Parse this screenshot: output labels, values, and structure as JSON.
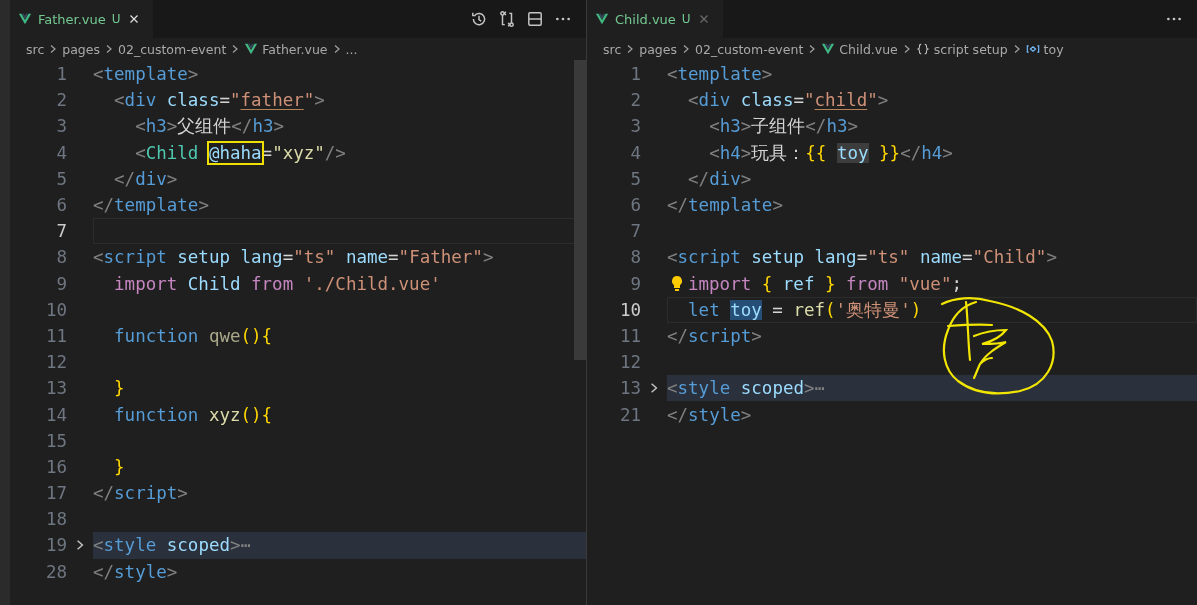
{
  "panes": [
    {
      "tab": {
        "label": "Father.vue",
        "status": "U",
        "focused": true
      },
      "actions": [
        {
          "kind": "history"
        },
        {
          "kind": "compare"
        },
        {
          "kind": "split"
        },
        {
          "kind": "more"
        }
      ],
      "breadcrumbs": [
        {
          "text": "src"
        },
        {
          "text": "pages"
        },
        {
          "text": "02_custom-event"
        },
        {
          "text": "Father.vue",
          "kind": "vue"
        },
        {
          "text": "..."
        }
      ],
      "scrollbar": true,
      "lines": [
        {
          "n": "1",
          "tokens": [
            {
              "text": "<",
              "kind": "p"
            },
            {
              "text": "template",
              "kind": "tag"
            },
            {
              "text": ">",
              "kind": "p"
            }
          ]
        },
        {
          "n": "2",
          "tokens": [
            {
              "text": "  <",
              "kind": "p"
            },
            {
              "text": "div",
              "kind": "tag"
            },
            {
              "text": " class",
              "kind": "attr"
            },
            {
              "text": "=",
              "kind": "plain"
            },
            {
              "text": "\"",
              "kind": "str"
            },
            {
              "text": "father",
              "kind": "str",
              "underlined": true
            },
            {
              "text": "\"",
              "kind": "str"
            },
            {
              "text": ">",
              "kind": "p"
            }
          ]
        },
        {
          "n": "3",
          "tokens": [
            {
              "text": "    <",
              "kind": "p"
            },
            {
              "text": "h3",
              "kind": "tag"
            },
            {
              "text": ">",
              "kind": "p"
            },
            {
              "text": "父组件",
              "kind": "plain"
            },
            {
              "text": "</",
              "kind": "p"
            },
            {
              "text": "h3",
              "kind": "tag"
            },
            {
              "text": ">",
              "kind": "p"
            }
          ]
        },
        {
          "n": "4",
          "tokens": [
            {
              "text": "    <",
              "kind": "p"
            },
            {
              "text": "Child ",
              "kind": "comp"
            },
            {
              "text": "@haha",
              "kind": "attr",
              "boxed": true
            },
            {
              "text": "=",
              "kind": "plain"
            },
            {
              "text": "\"xyz\"",
              "kind": "fn"
            },
            {
              "text": "/>",
              "kind": "p"
            }
          ]
        },
        {
          "n": "5",
          "tokens": [
            {
              "text": "  </",
              "kind": "p"
            },
            {
              "text": "div",
              "kind": "tag"
            },
            {
              "text": ">",
              "kind": "p"
            }
          ]
        },
        {
          "n": "6",
          "tokens": [
            {
              "text": "</",
              "kind": "p"
            },
            {
              "text": "template",
              "kind": "tag"
            },
            {
              "text": ">",
              "kind": "p"
            }
          ]
        },
        {
          "n": "7",
          "current": true
        },
        {
          "n": "8",
          "tokens": [
            {
              "text": "<",
              "kind": "p"
            },
            {
              "text": "script",
              "kind": "tag"
            },
            {
              "text": " setup lang",
              "kind": "attr"
            },
            {
              "text": "=",
              "kind": "plain"
            },
            {
              "text": "\"ts\"",
              "kind": "str"
            },
            {
              "text": " name",
              "kind": "attr"
            },
            {
              "text": "=",
              "kind": "plain"
            },
            {
              "text": "\"Father\"",
              "kind": "str"
            },
            {
              "text": ">",
              "kind": "p"
            }
          ]
        },
        {
          "n": "9",
          "tokens": [
            {
              "text": "  import",
              "kind": "kw"
            },
            {
              "text": " Child",
              "kind": "var"
            },
            {
              "text": " from",
              "kind": "kw"
            },
            {
              "text": " './Child.vue'",
              "kind": "str"
            }
          ]
        },
        {
          "n": "10"
        },
        {
          "n": "11",
          "tokens": [
            {
              "text": "  function",
              "kind": "store"
            },
            {
              "text": " qwe",
              "kind": "fndim"
            },
            {
              "text": "(){",
              "kind": "br"
            }
          ]
        },
        {
          "n": "12"
        },
        {
          "n": "13",
          "tokens": [
            {
              "text": "  }",
              "kind": "br"
            }
          ]
        },
        {
          "n": "14",
          "tokens": [
            {
              "text": "  function",
              "kind": "store"
            },
            {
              "text": " xyz",
              "kind": "fn"
            },
            {
              "text": "(){",
              "kind": "br"
            }
          ]
        },
        {
          "n": "15"
        },
        {
          "n": "16",
          "tokens": [
            {
              "text": "  }",
              "kind": "br"
            }
          ]
        },
        {
          "n": "17",
          "tokens": [
            {
              "text": "</",
              "kind": "p"
            },
            {
              "text": "script",
              "kind": "tag"
            },
            {
              "text": ">",
              "kind": "p"
            }
          ]
        },
        {
          "n": "18"
        },
        {
          "n": "19",
          "folded": true,
          "tokens": [
            {
              "text": "<",
              "kind": "p"
            },
            {
              "text": "style",
              "kind": "tag"
            },
            {
              "text": " scoped",
              "kind": "attr"
            },
            {
              "text": ">⋯",
              "kind": "p"
            }
          ]
        },
        {
          "n": "28",
          "tokens": [
            {
              "text": "</",
              "kind": "p"
            },
            {
              "text": "style",
              "kind": "tag"
            },
            {
              "text": ">",
              "kind": "p"
            }
          ]
        }
      ]
    },
    {
      "tab": {
        "label": "Child.vue",
        "status": "U",
        "focused": false
      },
      "actions": [
        {
          "kind": "more"
        }
      ],
      "breadcrumbs": [
        {
          "text": "src"
        },
        {
          "text": "pages"
        },
        {
          "text": "02_custom-event"
        },
        {
          "text": "Child.vue",
          "kind": "vue"
        },
        {
          "text": "script setup",
          "kind": "braces"
        },
        {
          "text": "toy",
          "kind": "symbol"
        }
      ],
      "annotation": true,
      "lines": [
        {
          "n": "1",
          "tokens": [
            {
              "text": "<",
              "kind": "p"
            },
            {
              "text": "template",
              "kind": "tag"
            },
            {
              "text": ">",
              "kind": "p"
            }
          ]
        },
        {
          "n": "2",
          "tokens": [
            {
              "text": "  <",
              "kind": "p"
            },
            {
              "text": "div",
              "kind": "tag"
            },
            {
              "text": " class",
              "kind": "attr"
            },
            {
              "text": "=",
              "kind": "plain"
            },
            {
              "text": "\"",
              "kind": "str"
            },
            {
              "text": "child",
              "kind": "str",
              "underlined": true
            },
            {
              "text": "\"",
              "kind": "str"
            },
            {
              "text": ">",
              "kind": "p"
            }
          ]
        },
        {
          "n": "3",
          "tokens": [
            {
              "text": "    <",
              "kind": "p"
            },
            {
              "text": "h3",
              "kind": "tag"
            },
            {
              "text": ">",
              "kind": "p"
            },
            {
              "text": "子组件",
              "kind": "plain"
            },
            {
              "text": "</",
              "kind": "p"
            },
            {
              "text": "h3",
              "kind": "tag"
            },
            {
              "text": ">",
              "kind": "p"
            }
          ]
        },
        {
          "n": "4",
          "tokens": [
            {
              "text": "    <",
              "kind": "p"
            },
            {
              "text": "h4",
              "kind": "tag"
            },
            {
              "text": ">",
              "kind": "p"
            },
            {
              "text": "玩具：",
              "kind": "plain"
            },
            {
              "text": "{{ ",
              "kind": "br"
            },
            {
              "text": "toy",
              "kind": "var",
              "highlighted": true
            },
            {
              "text": " }}",
              "kind": "br"
            },
            {
              "text": "</",
              "kind": "p"
            },
            {
              "text": "h4",
              "kind": "tag"
            },
            {
              "text": ">",
              "kind": "p"
            }
          ]
        },
        {
          "n": "5",
          "tokens": [
            {
              "text": "  </",
              "kind": "p"
            },
            {
              "text": "div",
              "kind": "tag"
            },
            {
              "text": ">",
              "kind": "p"
            }
          ]
        },
        {
          "n": "6",
          "tokens": [
            {
              "text": "</",
              "kind": "p"
            },
            {
              "text": "template",
              "kind": "tag"
            },
            {
              "text": ">",
              "kind": "p"
            }
          ]
        },
        {
          "n": "7"
        },
        {
          "n": "8",
          "tokens": [
            {
              "text": "<",
              "kind": "p"
            },
            {
              "text": "script",
              "kind": "tag"
            },
            {
              "text": " setup lang",
              "kind": "attr"
            },
            {
              "text": "=",
              "kind": "plain"
            },
            {
              "text": "\"ts\"",
              "kind": "str"
            },
            {
              "text": " name",
              "kind": "attr"
            },
            {
              "text": "=",
              "kind": "plain"
            },
            {
              "text": "\"Child\"",
              "kind": "str"
            },
            {
              "text": ">",
              "kind": "p"
            }
          ]
        },
        {
          "n": "9",
          "bulb": true,
          "tokens": [
            {
              "text": "import",
              "kind": "kw"
            },
            {
              "text": " {",
              "kind": "br"
            },
            {
              "text": " ref",
              "kind": "var"
            },
            {
              "text": " }",
              "kind": "br"
            },
            {
              "text": " from",
              "kind": "kw"
            },
            {
              "text": " \"vue\"",
              "kind": "str"
            },
            {
              "text": ";",
              "kind": "plain"
            }
          ]
        },
        {
          "n": "10",
          "current": true,
          "tokens": [
            {
              "text": "  let ",
              "kind": "store"
            },
            {
              "text": "toy",
              "kind": "var",
              "selected": true
            },
            {
              "text": " = ",
              "kind": "plain"
            },
            {
              "text": "ref",
              "kind": "fn"
            },
            {
              "text": "(",
              "kind": "br"
            },
            {
              "text": "'奥特曼'",
              "kind": "str"
            },
            {
              "text": ")",
              "kind": "br"
            }
          ]
        },
        {
          "n": "11",
          "tokens": [
            {
              "text": "</",
              "kind": "p"
            },
            {
              "text": "script",
              "kind": "tag"
            },
            {
              "text": ">",
              "kind": "p"
            }
          ]
        },
        {
          "n": "12"
        },
        {
          "n": "13",
          "folded": true,
          "tokens": [
            {
              "text": "<",
              "kind": "p"
            },
            {
              "text": "style",
              "kind": "tag"
            },
            {
              "text": " scoped",
              "kind": "attr"
            },
            {
              "text": ">⋯",
              "kind": "p"
            }
          ]
        },
        {
          "n": "21",
          "tokens": [
            {
              "text": "</",
              "kind": "p"
            },
            {
              "text": "style",
              "kind": "tag"
            },
            {
              "text": ">",
              "kind": "p"
            }
          ]
        }
      ]
    }
  ]
}
